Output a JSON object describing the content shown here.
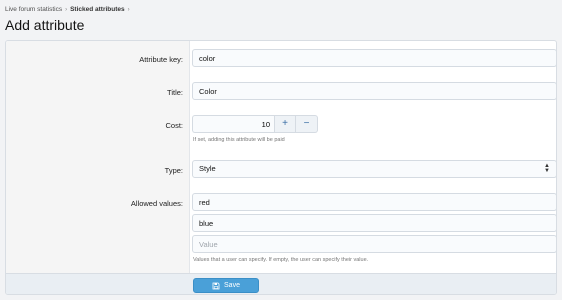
{
  "breadcrumb": {
    "items": [
      "Live forum statistics",
      "Sticked attributes"
    ]
  },
  "page": {
    "title": "Add attribute"
  },
  "form": {
    "attribute_key": {
      "label": "Attribute key:",
      "value": "color"
    },
    "title": {
      "label": "Title:",
      "value": "Color"
    },
    "cost": {
      "label": "Cost:",
      "value": "10",
      "increment_symbol": "+",
      "decrement_symbol": "−",
      "hint": "If set, adding this attribute will be paid"
    },
    "type": {
      "label": "Type:",
      "value": "Style"
    },
    "allowed_values": {
      "label": "Allowed values:",
      "values": [
        "red",
        "blue"
      ],
      "placeholder": "Value",
      "hint": "Values that a user can specify. If empty, the user can specify their value."
    },
    "save_label": "Save"
  },
  "colors": {
    "accent": "#4aa0d8",
    "background": "#f2f3f5"
  }
}
